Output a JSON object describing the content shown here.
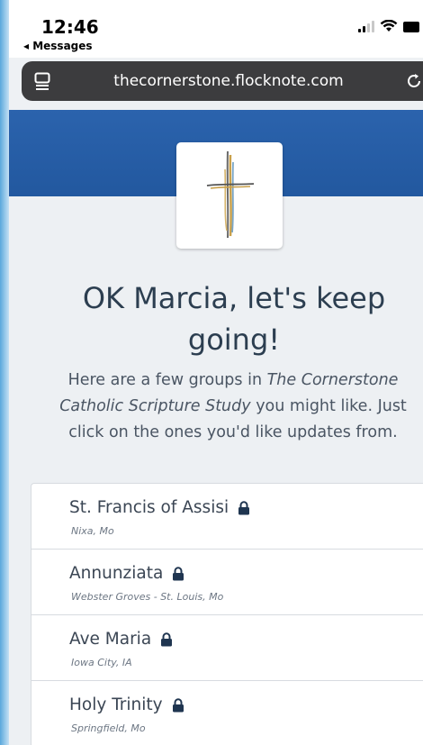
{
  "status_bar": {
    "time": "12:46",
    "back_label": "◂ Messages"
  },
  "browser": {
    "url": "thecornerstone.flocknote.com"
  },
  "page": {
    "heading_line1": "OK Marcia, let's keep",
    "heading_line2": "going!",
    "intro_line1": "Here are a few groups in ",
    "intro_org": "The Cornerstone",
    "intro_org2": "Catholic Scripture Study",
    "intro_line2_rest": " you might like. Just",
    "intro_line3": "click on the ones you'd like updates from."
  },
  "groups": [
    {
      "name": "St. Francis of Assisi",
      "location": "Nixa, Mo",
      "icon": "lock-icon"
    },
    {
      "name": "Annunziata",
      "location": "Webster Groves - St. Louis, Mo",
      "icon": "lock-icon"
    },
    {
      "name": "Ave Maria",
      "location": "Iowa City, IA",
      "icon": "lock-icon"
    },
    {
      "name": "Holy Trinity",
      "location": "Springfield, Mo",
      "icon": "lock-icon"
    }
  ],
  "colors": {
    "banner": "#2b63ad",
    "url_bar": "#3c3c3e",
    "heading_text": "#2c3e50"
  }
}
